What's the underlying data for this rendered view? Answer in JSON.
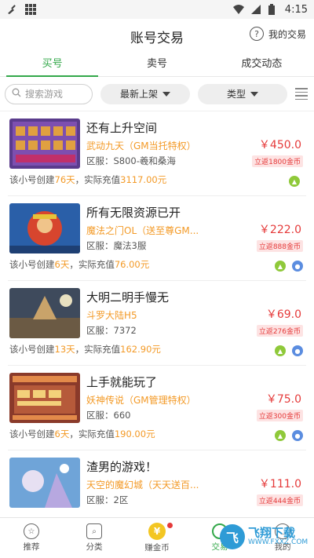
{
  "status": {
    "time": "4:15"
  },
  "header": {
    "title": "账号交易",
    "help_icon": "?",
    "my_trade": "我的交易"
  },
  "tabs": [
    {
      "label": "买号",
      "active": true
    },
    {
      "label": "卖号",
      "active": false
    },
    {
      "label": "成交动态",
      "active": false
    }
  ],
  "filter": {
    "search_placeholder": "搜索游戏",
    "sort_label": "最新上架",
    "type_label": "类型"
  },
  "items": [
    {
      "title": "还有上升空间",
      "game": "武动九天（GM当托特权）",
      "server": "区服：S800-羲和桑海",
      "price": "￥450.0",
      "rebate": "立返1800金币",
      "info_prefix": "该小号创建",
      "days": "76天",
      "info_mid": "，实际充值",
      "recharge": "3117.00元",
      "platforms": [
        "android"
      ],
      "thumb_colors": [
        "#5a3b8c",
        "#e0a040"
      ]
    },
    {
      "title": "所有无限资源已开",
      "game": "魔法之门OL（送至尊GM...",
      "server": "区服：魔法3服",
      "price": "￥222.0",
      "rebate": "立返888金币",
      "info_prefix": "该小号创建",
      "days": "6天",
      "info_mid": "，实际充值",
      "recharge": "76.00元",
      "platforms": [
        "android",
        "ios"
      ],
      "thumb_colors": [
        "#2a5fa8",
        "#d7452e"
      ]
    },
    {
      "title": "大明二明手慢无",
      "game": "斗罗大陆H5",
      "server": "区服：7372",
      "price": "￥69.0",
      "rebate": "立返276金币",
      "info_prefix": "该小号创建",
      "days": "13天",
      "info_mid": "，实际充值",
      "recharge": "162.90元",
      "platforms": [
        "android",
        "ios"
      ],
      "thumb_colors": [
        "#3e4a5c",
        "#c9a36a"
      ]
    },
    {
      "title": "上手就能玩了",
      "game": "妖神传说（GM管理特权）",
      "server": "区服：660",
      "price": "￥75.0",
      "rebate": "立返300金币",
      "info_prefix": "该小号创建",
      "days": "6天",
      "info_mid": "，实际充值",
      "recharge": "190.00元",
      "platforms": [
        "android",
        "ios"
      ],
      "thumb_colors": [
        "#8a3a2a",
        "#e38a4a"
      ]
    },
    {
      "title": "渣男的游戏！",
      "game": "天空的魔幻城（天天送百...",
      "server": "区服：2区",
      "price": "￥111.0",
      "rebate": "立返444金币",
      "info_prefix": "",
      "days": "",
      "info_mid": "",
      "recharge": "",
      "platforms": [],
      "thumb_colors": [
        "#6fa4d8",
        "#e7e0f2"
      ]
    }
  ],
  "bottom_nav": [
    {
      "label": "推荐",
      "icon": "star-icon"
    },
    {
      "label": "分类",
      "icon": "category-icon"
    },
    {
      "label": "赚金币",
      "icon": "coin-icon"
    },
    {
      "label": "交易",
      "icon": "trade-icon",
      "active": true
    },
    {
      "label": "我的",
      "icon": "user-icon"
    }
  ],
  "watermark": {
    "main": "飞翔下载",
    "sub": "WWW.FXXZ.COM",
    "logo_glyph": "飞"
  },
  "colors": {
    "accent": "#33a84a",
    "price": "#e53a3a",
    "game": "#f39a27"
  }
}
